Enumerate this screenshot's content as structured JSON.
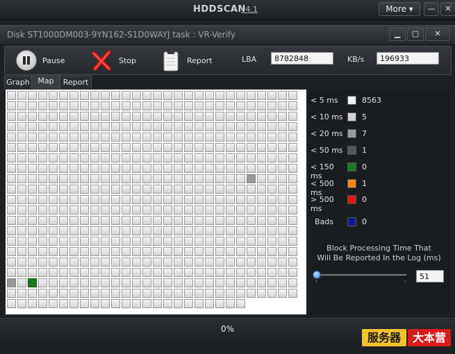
{
  "app": {
    "title": "HDDSCAN",
    "version": "v4.1",
    "more_label": "More ▾",
    "minimize_glyph": "—",
    "close_glyph": "✕"
  },
  "window": {
    "title": "Disk ST1000DM003-9YN162-S1D0WAYJ   task : VR-Verify",
    "min_glyph": "▁",
    "max_glyph": "▢",
    "close_glyph": "✕"
  },
  "toolbar": {
    "pause_label": "Pause",
    "stop_label": "Stop",
    "report_label": "Report",
    "lba_label": "LBA",
    "lba_value": "8782848",
    "kbs_label": "KB/s",
    "kbs_value": "196933"
  },
  "tabs": [
    {
      "label": "Graph"
    },
    {
      "label": "Map"
    },
    {
      "label": "Report"
    }
  ],
  "legend": [
    {
      "label": "< 5 ms",
      "color": "#f0f0f0",
      "count": "8563"
    },
    {
      "label": "< 10 ms",
      "color": "#d2d2d2",
      "count": "5"
    },
    {
      "label": "< 20 ms",
      "color": "#9b9b9b",
      "count": "7"
    },
    {
      "label": "< 50 ms",
      "color": "#555555",
      "count": "1"
    },
    {
      "label": "< 150 ms",
      "color": "#1a7b1a",
      "count": "0"
    },
    {
      "label": "< 500 ms",
      "color": "#f28b12",
      "count": "1"
    },
    {
      "label": "> 500 ms",
      "color": "#e01818",
      "count": "0"
    },
    {
      "label": "Bads",
      "color": "#0d1a8c",
      "count": "0"
    }
  ],
  "block_time": {
    "label_line1": "Block Processing Time That",
    "label_line2": "Will Be Reported In the Log (ms)",
    "value": "51"
  },
  "status": {
    "progress_text": "0%"
  },
  "watermark": {
    "part1": "服务器",
    "part2": "大本营"
  }
}
